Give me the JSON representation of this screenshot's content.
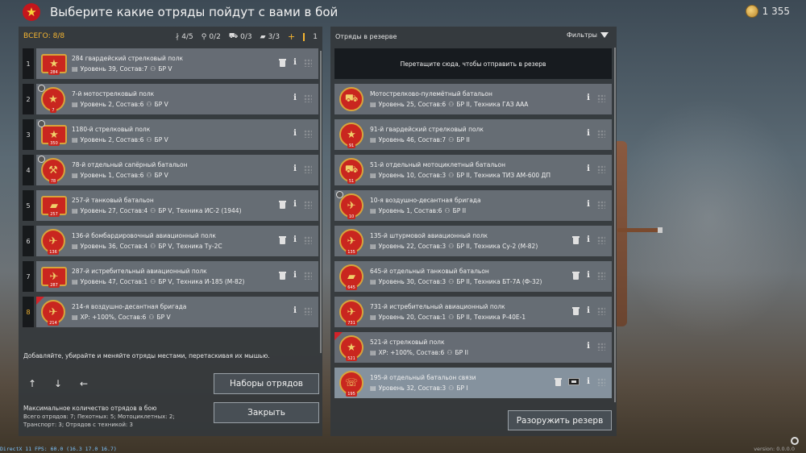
{
  "header": {
    "title": "Выберите какие отряды пойдут с вами в бой",
    "currency": "1 355"
  },
  "left": {
    "total": "ВСЕГО: 8/8",
    "counters": [
      {
        "icon": "infantry-icon",
        "glyph": "∤",
        "value": "4/5"
      },
      {
        "icon": "parachute-icon",
        "glyph": "⚲",
        "value": "0/2"
      },
      {
        "icon": "vehicle-icon",
        "glyph": "⛟",
        "value": "0/3"
      },
      {
        "icon": "tank-icon",
        "glyph": "▰",
        "value": "3/3"
      }
    ],
    "pipe_value": "1",
    "slots": [
      {
        "num": "1",
        "name": "284 гвардейский стрелковый полк",
        "stats": "Уровень 39, Состав:7",
        "br": "БР V",
        "tech": "",
        "glyph": "★",
        "level": "284",
        "trash": true,
        "flag": true,
        "dot": false,
        "tri": false
      },
      {
        "num": "2",
        "name": "7-й мотострелковый полк",
        "stats": "Уровень 2, Состав:6",
        "br": "БР V",
        "tech": "",
        "glyph": "★",
        "level": "7",
        "trash": false,
        "flag": false,
        "dot": true,
        "tri": false
      },
      {
        "num": "3",
        "name": "1180-й стрелковый полк",
        "stats": "Уровень 2, Состав:6",
        "br": "БР V",
        "tech": "",
        "glyph": "★",
        "level": "350",
        "trash": false,
        "flag": true,
        "dot": true,
        "tri": false
      },
      {
        "num": "4",
        "name": "78-й отдельный сапёрный батальон",
        "stats": "Уровень 1, Состав:6",
        "br": "БР V",
        "tech": "",
        "glyph": "⚒",
        "level": "78",
        "trash": false,
        "flag": false,
        "dot": true,
        "tri": false
      },
      {
        "num": "5",
        "name": "257-й танковый батальон",
        "stats": "Уровень 27, Состав:4",
        "br": "БР V,",
        "tech": "Техника ИС-2 (1944)",
        "glyph": "▰",
        "level": "257",
        "trash": true,
        "flag": true,
        "dot": false,
        "tri": false
      },
      {
        "num": "6",
        "name": "136-й бомбардировочный авиационный полк",
        "stats": "Уровень 36, Состав:4",
        "br": "БР V,",
        "tech": "Техника Ту-2С",
        "glyph": "✈",
        "level": "136",
        "trash": true,
        "flag": false,
        "dot": false,
        "tri": false
      },
      {
        "num": "7",
        "name": "287-й истребительный авиационный полк",
        "stats": "Уровень 47, Состав:1",
        "br": "БР V,",
        "tech": "Техника И-185 (М-82)",
        "glyph": "✈",
        "level": "287",
        "trash": true,
        "flag": true,
        "dot": false,
        "tri": false
      },
      {
        "num": "8",
        "name": "214-я воздушно-десантная бригада",
        "stats": "XP: +100%, Состав:6",
        "br": "БР V",
        "tech": "",
        "glyph": "✈",
        "level": "214",
        "trash": false,
        "flag": false,
        "dot": false,
        "tri": true
      }
    ],
    "hint": "Добавляйте, убирайте и меняйте отряды местами, перетаскивая их мышью.",
    "arrows": [
      "↑",
      "↓",
      "←"
    ],
    "sets_button": "Наборы отрядов",
    "close_button": "Закрыть",
    "max_title": "Максимальное количество отрядов в бою",
    "max_line1": "Всего отрядов: 7; Пехотных: 5; Мотоциклетных: 2;",
    "max_line2": "Транспорт: 3; Отрядов с техникой: 3"
  },
  "right": {
    "title": "Отряды в резерве",
    "filters": "Фильтры",
    "dropzone": "Перетащите сюда, чтобы отправить в резерв",
    "units": [
      {
        "name": "Мотострелково-пулемётный батальон",
        "stats": "Уровень 25, Состав:6",
        "br": "БР II,",
        "tech": "Техника ГАЗ ААА",
        "glyph": "⛟",
        "level": "",
        "trash": false,
        "dot": false,
        "tri": false,
        "selected": false,
        "ammo": false
      },
      {
        "name": "91-й гвардейский стрелковый полк",
        "stats": "Уровень 46, Состав:7",
        "br": "БР II",
        "tech": "",
        "glyph": "★",
        "level": "91",
        "trash": false,
        "dot": false,
        "tri": false,
        "selected": false,
        "ammo": false
      },
      {
        "name": "51-й отдельный мотоциклетный батальон",
        "stats": "Уровень 10, Состав:3",
        "br": "БР II,",
        "tech": "Техника ТИЗ АМ-600 ДП",
        "glyph": "⛟",
        "level": "51",
        "trash": false,
        "dot": false,
        "tri": false,
        "selected": false,
        "ammo": false
      },
      {
        "name": "10-я воздушно-десантная бригада",
        "stats": "Уровень 1, Состав:6",
        "br": "БР II",
        "tech": "",
        "glyph": "✈",
        "level": "10",
        "trash": false,
        "dot": true,
        "tri": false,
        "selected": false,
        "ammo": false
      },
      {
        "name": "135-й штурмовой авиационный полк",
        "stats": "Уровень 22, Состав:3",
        "br": "БР II,",
        "tech": "Техника Су-2 (М-82)",
        "glyph": "✈",
        "level": "135",
        "trash": true,
        "dot": false,
        "tri": false,
        "selected": false,
        "ammo": false
      },
      {
        "name": "645-й отдельный танковый батальон",
        "stats": "Уровень 30, Состав:3",
        "br": "БР II,",
        "tech": "Техника БТ-7А (Ф-32)",
        "glyph": "▰",
        "level": "645",
        "trash": true,
        "dot": false,
        "tri": false,
        "selected": false,
        "ammo": false
      },
      {
        "name": "731-й истребительный авиационный полк",
        "stats": "Уровень 20, Состав:1",
        "br": "БР II,",
        "tech": "Техника Р-40Е-1",
        "glyph": "✈",
        "level": "731",
        "trash": true,
        "dot": false,
        "tri": false,
        "selected": false,
        "ammo": false
      },
      {
        "name": "521-й стрелковый полк",
        "stats": "XP: +100%, Состав:6",
        "br": "БР II",
        "tech": "",
        "glyph": "★",
        "level": "521",
        "trash": false,
        "dot": false,
        "tri": true,
        "selected": false,
        "ammo": false
      },
      {
        "name": "195-й отдельный батальон связи",
        "stats": "Уровень 32, Состав:3",
        "br": "БР I",
        "tech": "",
        "glyph": "☏",
        "level": "195",
        "trash": true,
        "dot": false,
        "tri": false,
        "selected": true,
        "ammo": true
      }
    ],
    "disarm_button": "Разоружить резерв"
  },
  "footer": {
    "debug": "DirectX 11 FPS: 60.0 (16.3 17.0 16.7)",
    "version": "version: 0.0.0.0"
  }
}
